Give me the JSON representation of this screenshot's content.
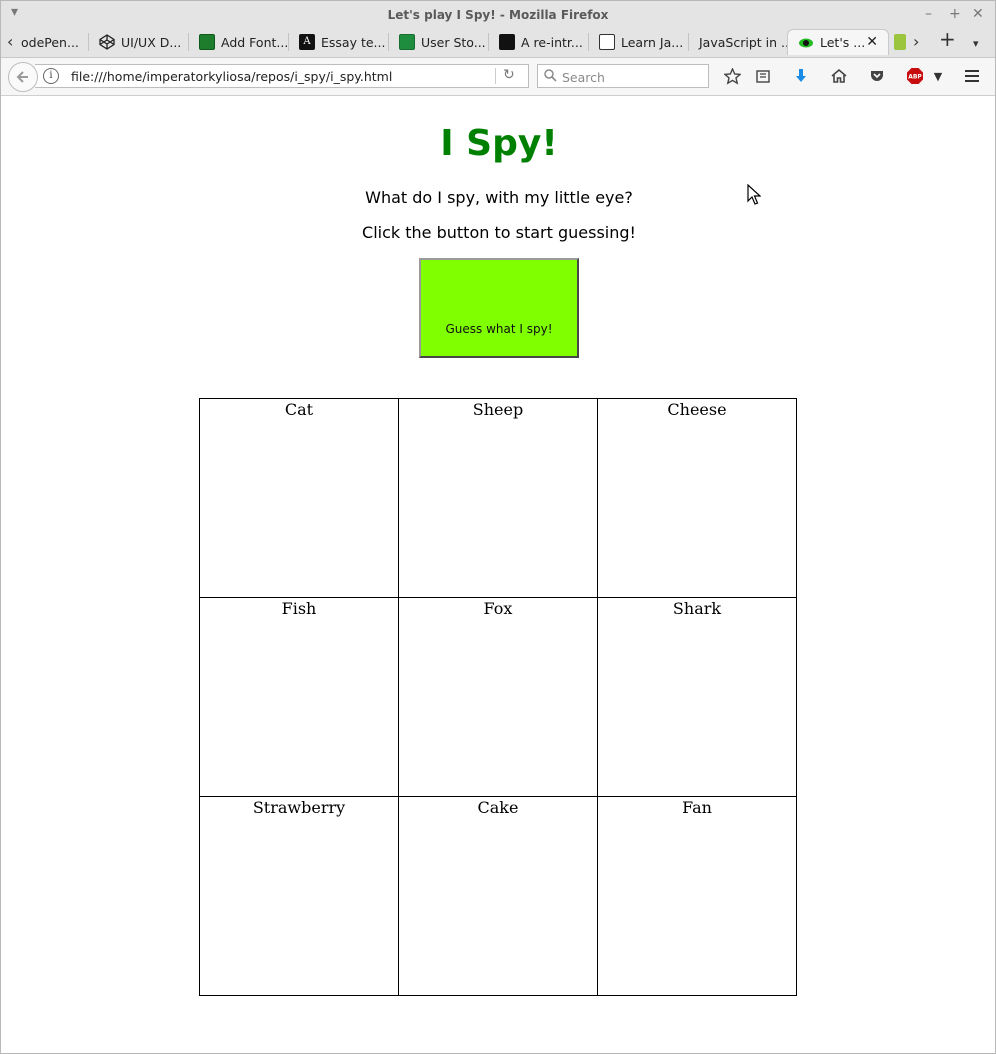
{
  "window": {
    "title": "Let's play I Spy! - Mozilla Firefox"
  },
  "tabs": [
    {
      "label": "odePen...",
      "icon": "codepen-icon"
    },
    {
      "label": "UI/UX D...",
      "icon": "codepen-icon"
    },
    {
      "label": "Add Font...",
      "icon": "font-icon"
    },
    {
      "label": "Essay te...",
      "icon": "text-icon"
    },
    {
      "label": "User Sto...",
      "icon": "spreadsheet-icon"
    },
    {
      "label": "A re-intr...",
      "icon": "page-icon"
    },
    {
      "label": "Learn Ja...",
      "icon": "code-icon"
    },
    {
      "label": "JavaScript in ...",
      "icon": ""
    },
    {
      "label": "Let's ...",
      "icon": "eye-icon",
      "active": true
    }
  ],
  "navbar": {
    "url": "file:///home/imperatorkyliosa/repos/i_spy/i_spy.html",
    "search_placeholder": "Search"
  },
  "page": {
    "heading": "I Spy!",
    "line1": "What do I spy, with my little eye?",
    "line2": "Click the button to start guessing!",
    "button_label": "Guess what I spy!",
    "grid": [
      [
        "Cat",
        "Sheep",
        "Cheese"
      ],
      [
        "Fish",
        "Fox",
        "Shark"
      ],
      [
        "Strawberry",
        "Cake",
        "Fan"
      ]
    ]
  },
  "colors": {
    "heading": "#008000",
    "button_bg": "#7fff00",
    "abp_red": "#c70d0d",
    "download_blue": "#1a8ce8"
  }
}
